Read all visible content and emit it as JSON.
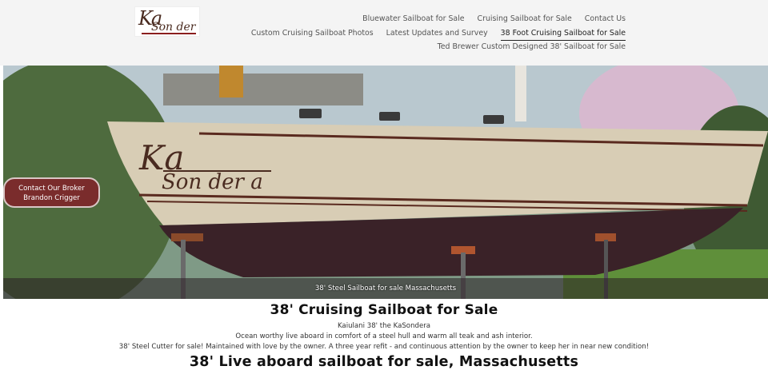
{
  "logo": {
    "text_top": "Ka",
    "text_bottom": "Son der a"
  },
  "nav": {
    "row1": [
      "Bluewater Sailboat for Sale",
      "Cruising Sailboat for Sale",
      "Contact Us"
    ],
    "row2": [
      "Custom Cruising Sailboat Photos",
      "Latest Updates and Survey",
      "38 Foot Cruising Sailboat for Sale"
    ],
    "row3": [
      "Ted Brewer Custom Designed 38' Sailboat for Sale"
    ],
    "active": "38 Foot Cruising Sailboat for Sale"
  },
  "hero": {
    "boat_name_top": "Ka",
    "boat_name_bottom": "Son der a",
    "caption": "38' Steel Sailboat for sale Massachusetts"
  },
  "broker_button": {
    "label": "Contact Our Broker Brandon Crigger"
  },
  "main": {
    "title": "38' Cruising Sailboat for Sale",
    "lines": [
      "Kaiulani 38' the KaSondera",
      "Ocean worthy live aboard in comfort of a steel hull and warm all teak and ash interior.",
      "38' Steel Cutter for sale! Maintained with love by the owner. A three year refit - and continuous attention by the owner to keep her in near new condition!"
    ],
    "subtitle": "38' Live aboard sailboat for sale, Massachusetts"
  },
  "colors": {
    "accent": "#7a2c2c",
    "hull_bottom": "#3a2228",
    "hull_top": "#d8cdb5"
  }
}
